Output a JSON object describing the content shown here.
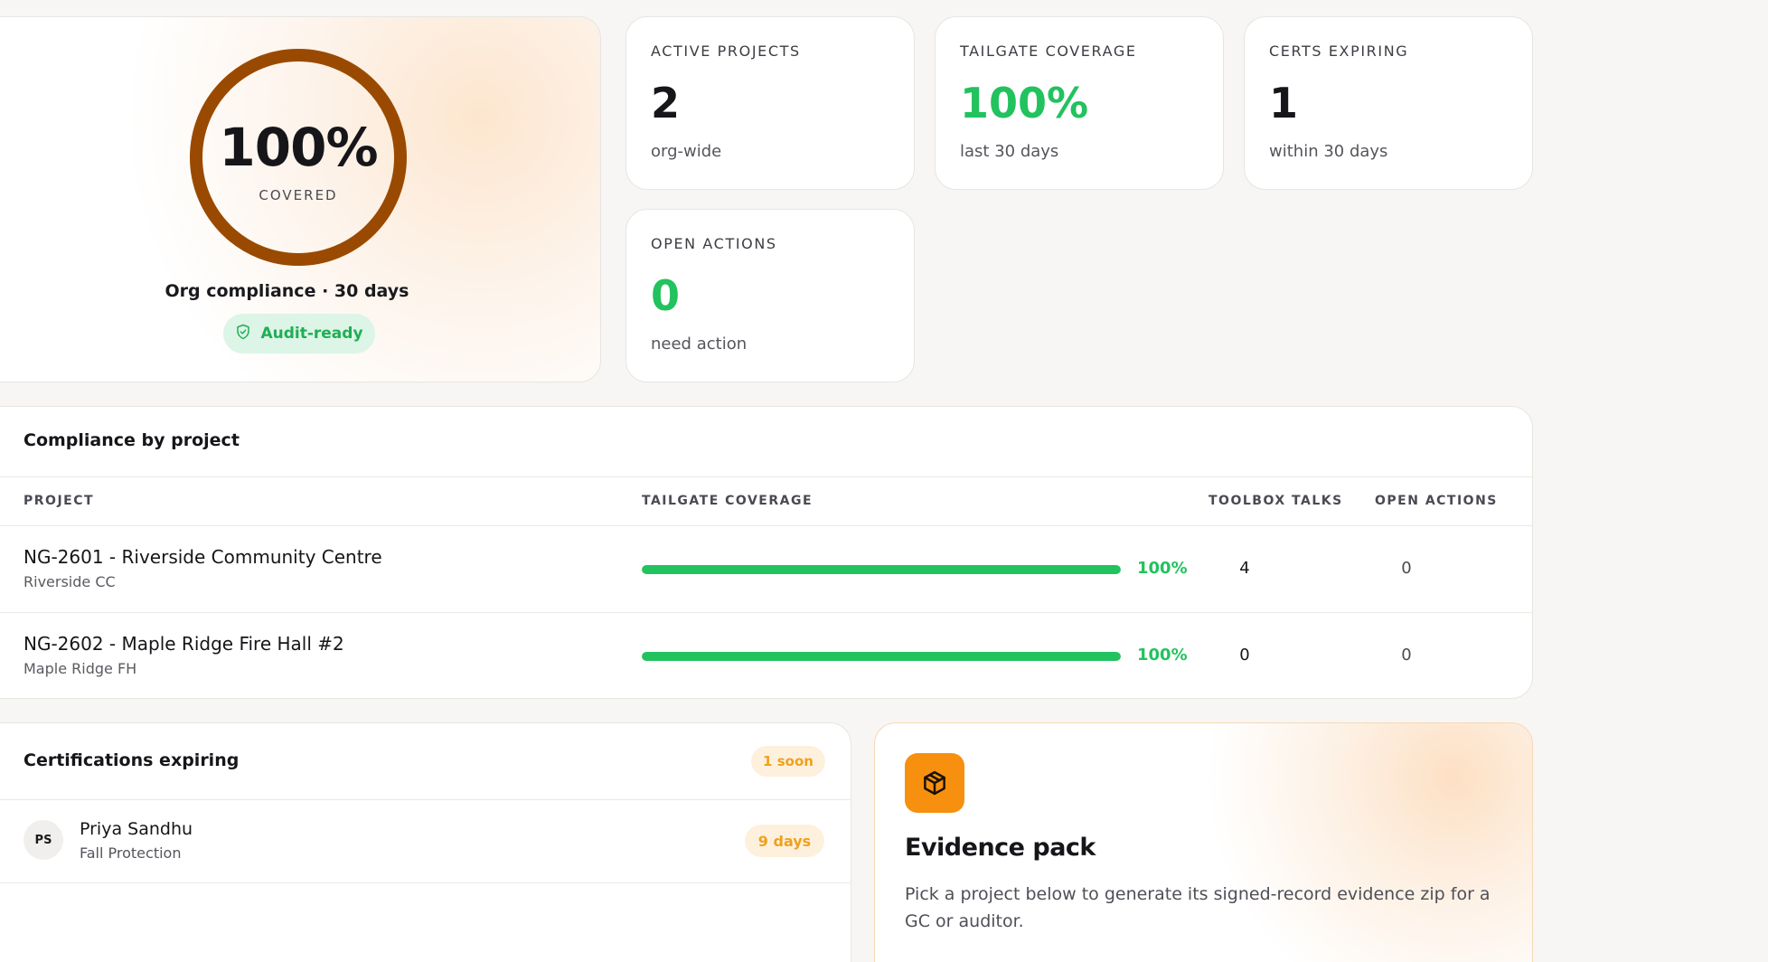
{
  "hero": {
    "coverage_value": "100%",
    "coverage_label": "COVERED",
    "coverage_fraction": 1.0,
    "ring_color": "#9a4a00",
    "caption": "Org compliance · 30 days",
    "badge": "Audit-ready"
  },
  "stats": [
    {
      "label": "ACTIVE PROJECTS",
      "value": "2",
      "sub": "org-wide"
    },
    {
      "label": "TAILGATE COVERAGE",
      "value": "100%",
      "sub": "last 30 days"
    },
    {
      "label": "CERTS EXPIRING",
      "value": "1",
      "sub": "within 30 days"
    },
    {
      "label": "OPEN ACTIONS",
      "value": "0",
      "sub": "need action"
    }
  ],
  "projects": {
    "title": "Compliance by project",
    "columns": [
      "PROJECT",
      "TAILGATE COVERAGE",
      "TOOLBOX TALKS",
      "OPEN ACTIONS"
    ],
    "rows": [
      {
        "name": "NG-2601 - Riverside Community Centre",
        "short": "Riverside CC",
        "coverage": "100%",
        "coverage_fraction": 1.0,
        "talks": "4",
        "actions": "0"
      },
      {
        "name": "NG-2602 - Maple Ridge Fire Hall #2",
        "short": "Maple Ridge FH",
        "coverage": "100%",
        "coverage_fraction": 1.0,
        "talks": "0",
        "actions": "0"
      }
    ]
  },
  "certs": {
    "title": "Certifications expiring",
    "badge": "1 soon",
    "items": [
      {
        "initials": "PS",
        "name": "Priya Sandhu",
        "cert": "Fall Protection",
        "days": "9 days"
      }
    ]
  },
  "evidence": {
    "icon": "package-icon",
    "title": "Evidence pack",
    "description": "Pick a project below to generate its signed-record evidence zip for a GC or auditor."
  },
  "colors": {
    "green": "#22c25e",
    "amber": "#f0a01c",
    "orange": "#f7900e"
  }
}
